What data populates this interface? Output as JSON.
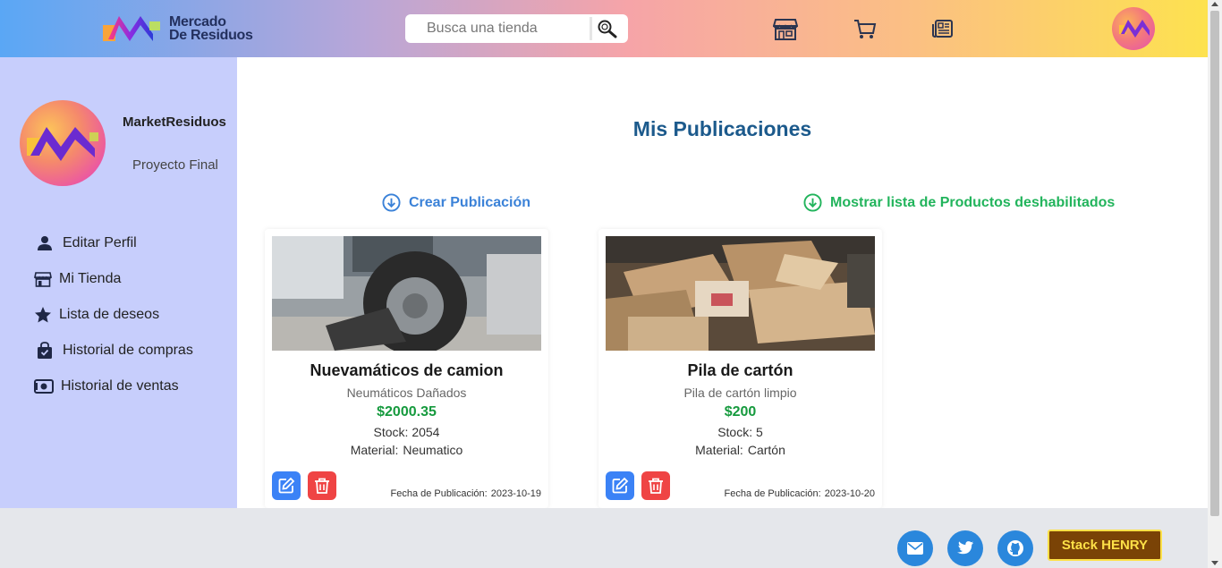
{
  "header": {
    "logo_line1": "Mercado",
    "logo_line2": "De Residuos",
    "search_placeholder": "Busca una tienda",
    "icons": [
      "search-icon",
      "store-icon",
      "cart-icon",
      "news-icon"
    ]
  },
  "sidebar": {
    "profile_name": "MarketResiduos",
    "profile_subtitle": "Proyecto Final",
    "items": [
      {
        "label": "Editar Perfil",
        "icon": "user-icon"
      },
      {
        "label": "Mi Tienda",
        "icon": "store-icon"
      },
      {
        "label": "Lista de deseos",
        "icon": "star-icon"
      },
      {
        "label": "Historial de compras",
        "icon": "shopping-bag-icon"
      },
      {
        "label": "Historial de ventas",
        "icon": "cash-icon"
      }
    ]
  },
  "main": {
    "title": "Mis Publicaciones",
    "create_label": "Crear Publicación",
    "disabled_label": "Mostrar lista de Productos deshabilitados",
    "material_label": "Material:",
    "date_label": "Fecha de Publicación:",
    "cards": [
      {
        "title": "Nuevamáticos de camion",
        "description": "Neumáticos Dañados",
        "price": "$2000.35",
        "stock": "Stock: 2054",
        "material": "Neumatico",
        "date": "2023-10-19"
      },
      {
        "title": "Pila de cartón",
        "description": "Pila de cartón limpio",
        "price": "$200",
        "stock": "Stock: 5",
        "material": "Cartón",
        "date": "2023-10-20"
      }
    ]
  },
  "footer": {
    "stack_label": "Stack HENRY",
    "social_icons": [
      "mail-icon",
      "twitter-icon",
      "github-icon"
    ]
  },
  "colors": {
    "sidebar_bg": "#c7cefc",
    "title": "#1c5a8c",
    "create_action": "#3b82d8",
    "disabled_action": "#22b45c",
    "price": "#169a3e",
    "edit_button": "#3b82f6",
    "delete_button": "#ef4444",
    "stack_button_bg": "#7a4306",
    "stack_button_text": "#fde047",
    "social_button": "#2a87dc"
  }
}
